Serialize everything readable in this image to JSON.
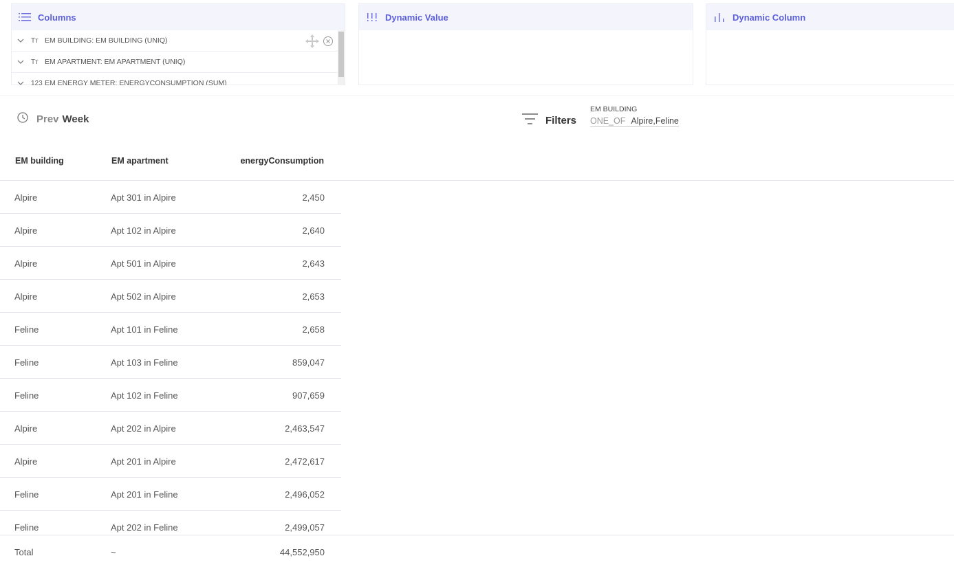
{
  "panels": {
    "columns": {
      "title": "Columns",
      "icon": "list-icon",
      "items": [
        {
          "type": "Tт",
          "label": "EM BUILDING: EM BUILDING (UNIQ)"
        },
        {
          "type": "Tт",
          "label": "EM APARTMENT: EM APARTMENT (UNIQ)"
        },
        {
          "type": "123",
          "label": "EM ENERGY METER: ENERGYCONSUMPTION (SUM)"
        }
      ]
    },
    "dynamic_value": {
      "title": "Dynamic Value",
      "icon": "bars-icon"
    },
    "dynamic_column": {
      "title": "Dynamic Column",
      "icon": "bar-chart-icon"
    }
  },
  "toolbar": {
    "time_prev": "Prev",
    "time_period": "Week",
    "filters_label": "Filters",
    "filter": {
      "field": "EM BUILDING",
      "operator": "ONE_OF",
      "values": "Alpire,Feline"
    }
  },
  "table": {
    "headers": [
      "EM building",
      "EM apartment",
      "energyConsumption"
    ],
    "rows": [
      [
        "Alpire",
        "Apt 301 in Alpire",
        "2,450"
      ],
      [
        "Alpire",
        "Apt 102 in Alpire",
        "2,640"
      ],
      [
        "Alpire",
        "Apt 501 in Alpire",
        "2,643"
      ],
      [
        "Alpire",
        "Apt 502 in Alpire",
        "2,653"
      ],
      [
        "Feline",
        "Apt 101 in Feline",
        "2,658"
      ],
      [
        "Feline",
        "Apt 103 in Feline",
        "859,047"
      ],
      [
        "Feline",
        "Apt 102 in Feline",
        "907,659"
      ],
      [
        "Alpire",
        "Apt 202 in Alpire",
        "2,463,547"
      ],
      [
        "Alpire",
        "Apt 201 in Alpire",
        "2,472,617"
      ],
      [
        "Feline",
        "Apt 201 in Feline",
        "2,496,052"
      ],
      [
        "Feline",
        "Apt 202 in Feline",
        "2,499,057"
      ]
    ],
    "total": {
      "label": "Total",
      "c2": "~",
      "c3": "44,552,950"
    }
  },
  "colors": {
    "accent": "#5b5fd9",
    "panel_header_bg": "#f4f5fc",
    "border": "#e3e5ea"
  }
}
